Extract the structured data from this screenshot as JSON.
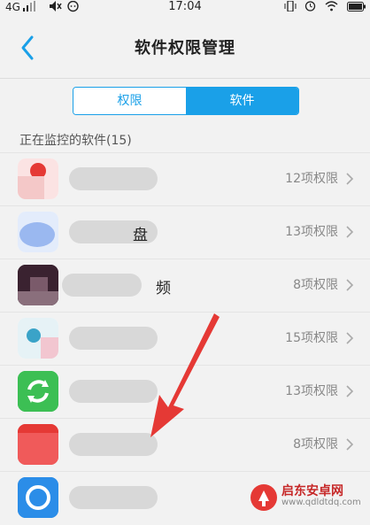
{
  "statusbar": {
    "network": "4G",
    "time": "17:04"
  },
  "header": {
    "title": "软件权限管理"
  },
  "segment": {
    "tab_permissions": "权限",
    "tab_software": "软件"
  },
  "section": {
    "title": "正在监控的软件(15)"
  },
  "apps": [
    {
      "name_visible": "",
      "count": "12项权限"
    },
    {
      "name_visible": "盘",
      "count": "13项权限"
    },
    {
      "name_visible": "频",
      "count": "8项权限"
    },
    {
      "name_visible": "",
      "count": "15项权限"
    },
    {
      "name_visible": "",
      "count": "13项权限"
    },
    {
      "name_visible": "",
      "count": "8项权限"
    },
    {
      "name_visible": "",
      "count": ""
    }
  ],
  "watermark": {
    "brand": "启东安卓网",
    "url": "www.qdldtdq.com"
  },
  "colors": {
    "accent": "#1aa0e8",
    "arrow": "#e53935"
  }
}
